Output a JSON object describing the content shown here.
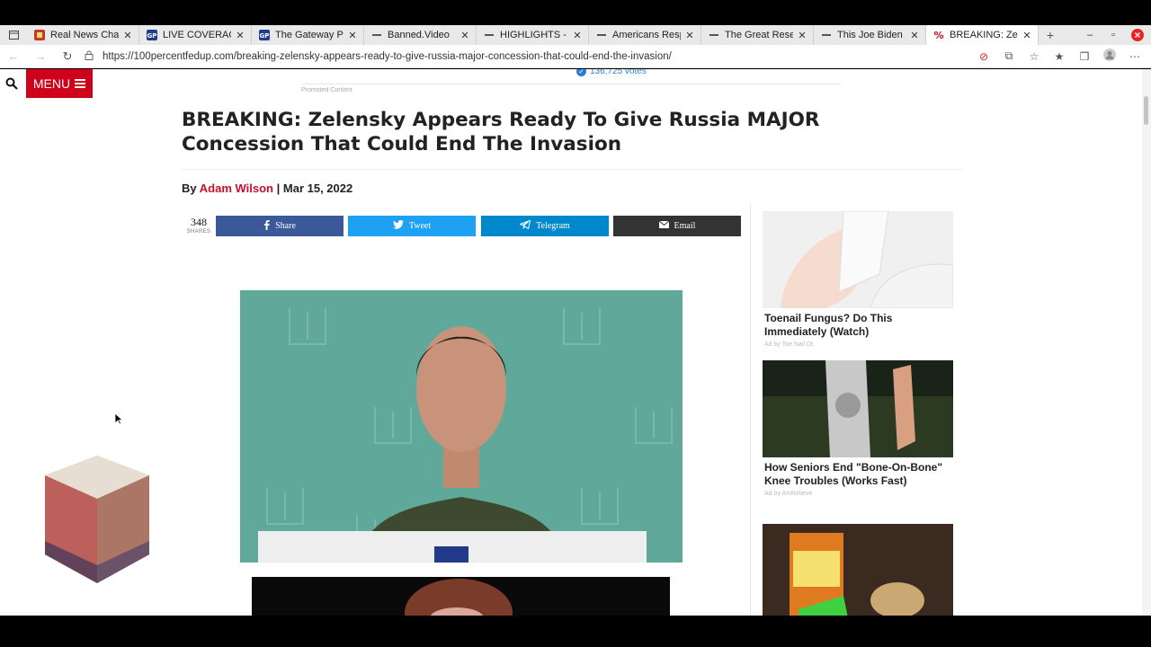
{
  "browser": {
    "tabs": [
      {
        "title": "Real News Chann",
        "favicon": "rn"
      },
      {
        "title": "LIVE COVERAGE:",
        "favicon": "gp"
      },
      {
        "title": "The Gateway Pun",
        "favicon": "gp"
      },
      {
        "title": "Banned.Video",
        "favicon": "page"
      },
      {
        "title": "HIGHLIGHTS - Am",
        "favicon": "page"
      },
      {
        "title": "Americans Respo",
        "favicon": "page"
      },
      {
        "title": "The Great Reset F",
        "favicon": "page"
      },
      {
        "title": "This Joe Biden Cl",
        "favicon": "page"
      },
      {
        "title": "BREAKING: Zelen",
        "favicon": "percent",
        "active": true
      }
    ],
    "url": "https://100percentfedup.com/breaking-zelensky-appears-ready-to-give-russia-major-concession-that-could-end-the-invasion/"
  },
  "header": {
    "menu_label": "MENU",
    "votes_text": "136,725 votes",
    "promoted_label": "Promoted Content"
  },
  "article": {
    "headline": "BREAKING: Zelensky Appears Ready To Give Russia MAJOR Concession That Could End The Invasion",
    "by_label": "By",
    "author": "Adam Wilson",
    "separator": "|",
    "date": "Mar 15, 2022"
  },
  "share": {
    "count": "348",
    "count_label": "SHARES",
    "buttons": [
      {
        "label": "Share",
        "icon": "facebook-icon",
        "color": "#3b5998"
      },
      {
        "label": "Tweet",
        "icon": "twitter-icon",
        "color": "#1da1f2"
      },
      {
        "label": "Telegram",
        "icon": "telegram-icon",
        "color": "#0088cc"
      },
      {
        "label": "Email",
        "icon": "email-icon",
        "color": "#333333"
      }
    ]
  },
  "ads": [
    {
      "title": "Toenail Fungus? Do This Immediately (Watch)",
      "source": "Ad by Toe Nail Dr."
    },
    {
      "title": "How Seniors End \"Bone-On-Bone\" Knee Troubles (Works Fast)",
      "source": "Ad by AmRelieve"
    },
    {
      "title": "",
      "source": ""
    }
  ],
  "colors": {
    "accent": "#d0011b",
    "author": "#c8102e",
    "hero_bg": "#5fa89a"
  }
}
